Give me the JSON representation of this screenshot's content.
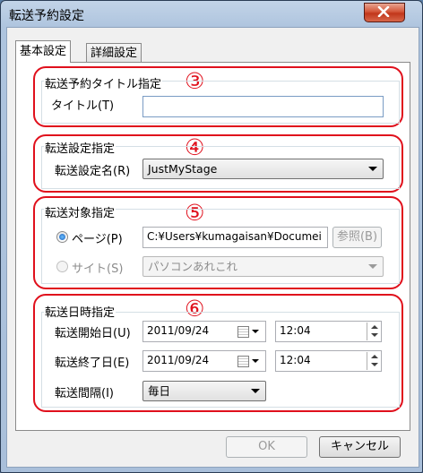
{
  "window": {
    "title": "転送予約設定"
  },
  "tabs": [
    {
      "label": "基本設定",
      "active": true
    },
    {
      "label": "詳細設定",
      "active": false
    }
  ],
  "annotations": [
    "③",
    "④",
    "⑤",
    "⑥"
  ],
  "group_title": {
    "label": "転送予約タイトル指定",
    "title_label": "タイトル(T)",
    "title_value": ""
  },
  "group_transfer": {
    "label": "転送設定指定",
    "name_label": "転送設定名(R)",
    "name_value": "JustMyStage"
  },
  "group_target": {
    "label": "転送対象指定",
    "page_radio_label": "ページ(P)",
    "page_path": "C:¥Users¥kumagaisan¥Documei",
    "browse_label": "参照(B)",
    "site_radio_label": "サイト(S)",
    "site_value": "パソコンあれこれ"
  },
  "group_schedule": {
    "label": "転送日時指定",
    "start_label": "転送開始日(U)",
    "start_date": "2011/09/24",
    "start_time": "12:04",
    "end_label": "転送終了日(E)",
    "end_date": "2011/09/24",
    "end_time": "12:04",
    "interval_label": "転送間隔(I)",
    "interval_value": "毎日"
  },
  "footer": {
    "ok_label": "OK",
    "cancel_label": "キャンセル"
  },
  "colors": {
    "annotation_red": "#e0101c",
    "close_button": "#c1361a",
    "titlebar": "#aec4de"
  }
}
